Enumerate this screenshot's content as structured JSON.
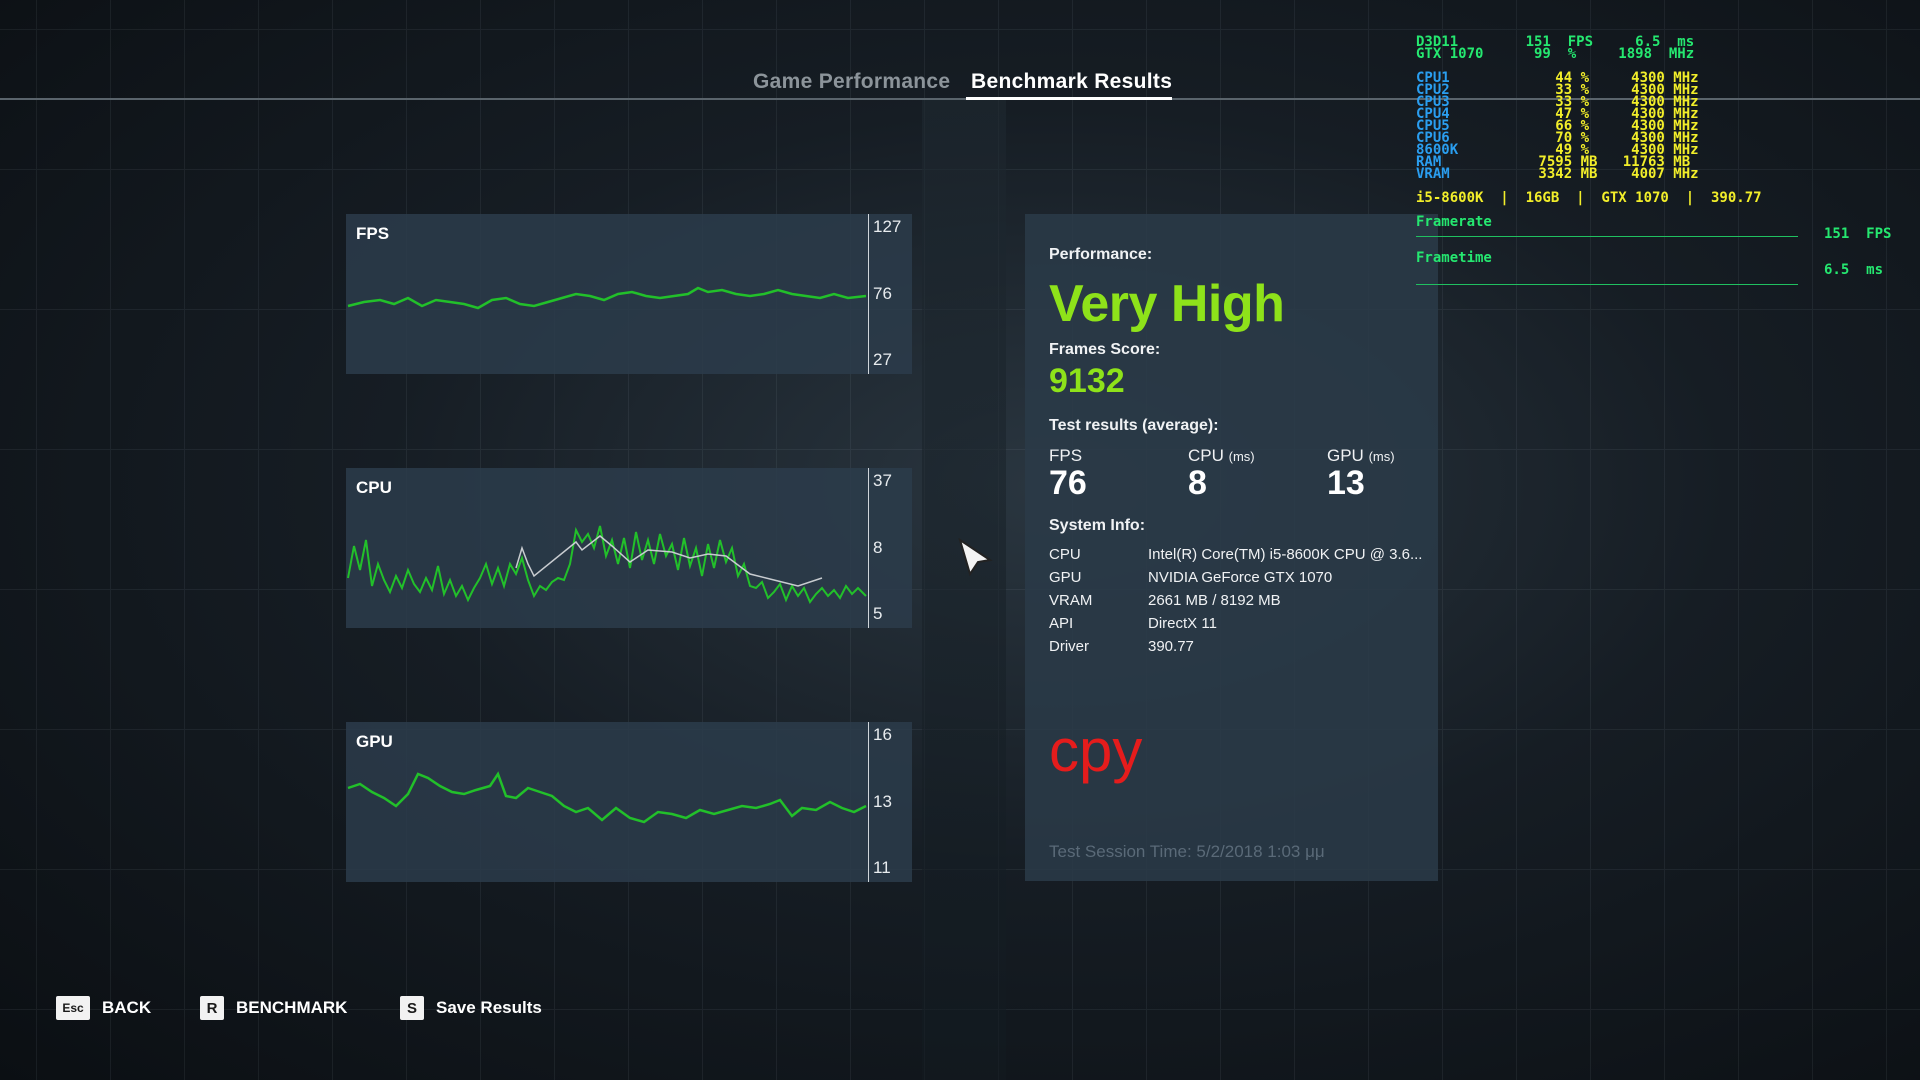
{
  "tabs": [
    {
      "label": "Game Performance",
      "active": false
    },
    {
      "label": "Benchmark Results",
      "active": true
    }
  ],
  "graphs": {
    "fps": {
      "title": "FPS",
      "ticks": [
        "127",
        "76",
        "27"
      ],
      "series_color": "#22c02a"
    },
    "cpu": {
      "title": "CPU",
      "ticks": [
        "37",
        "8",
        "5"
      ],
      "series_color": "#22c02a"
    },
    "gpu": {
      "title": "GPU",
      "ticks": [
        "16",
        "13",
        "11"
      ],
      "series_color": "#22c02a"
    }
  },
  "results": {
    "performance_label": "Performance:",
    "performance_value": "Very High",
    "score_label": "Frames Score:",
    "score_value": "9132",
    "test_label": "Test results (average):",
    "stats": [
      {
        "label": "FPS",
        "unit": "",
        "value": "76"
      },
      {
        "label": "CPU",
        "unit": "(ms)",
        "value": "8"
      },
      {
        "label": "GPU",
        "unit": "(ms)",
        "value": "13"
      }
    ],
    "system_label": "System Info:",
    "system": [
      {
        "key": "CPU",
        "value": "Intel(R) Core(TM) i5-8600K CPU @ 3.6..."
      },
      {
        "key": "GPU",
        "value": "NVIDIA GeForce GTX 1070"
      },
      {
        "key": "VRAM",
        "value": "2661 MB / 8192 MB"
      },
      {
        "key": "API",
        "value": "DirectX 11"
      },
      {
        "key": "Driver",
        "value": "390.77"
      }
    ],
    "stamp": "cpy",
    "session": "Test Session Time: 5/2/2018 1:03 μμ"
  },
  "overlay": {
    "d3d_line": "D3D11        151  FPS     6.5  ms",
    "gtx_line": "GTX 1070      99  %     1898  MHz",
    "cpu_rows": [
      {
        "name": "CPU1",
        "value": "44",
        "unit": "%",
        "clock": "4300",
        "clock_unit": "MHz"
      },
      {
        "name": "CPU2",
        "value": "33",
        "unit": "%",
        "clock": "4300",
        "clock_unit": "MHz"
      },
      {
        "name": "CPU3",
        "value": "33",
        "unit": "%",
        "clock": "4300",
        "clock_unit": "MHz"
      },
      {
        "name": "CPU4",
        "value": "47",
        "unit": "%",
        "clock": "4300",
        "clock_unit": "MHz"
      },
      {
        "name": "CPU5",
        "value": "66",
        "unit": "%",
        "clock": "4300",
        "clock_unit": "MHz"
      },
      {
        "name": "CPU6",
        "value": "70",
        "unit": "%",
        "clock": "4300",
        "clock_unit": "MHz"
      },
      {
        "name": "8600K",
        "value": "49",
        "unit": "%",
        "clock": "4300",
        "clock_unit": "MHz"
      },
      {
        "name": "RAM",
        "value": "7595",
        "unit": "MB",
        "clock": "11763",
        "clock_unit": "MB"
      },
      {
        "name": "VRAM",
        "value": "3342",
        "unit": "MB",
        "clock": "4007",
        "clock_unit": "MHz"
      }
    ],
    "system_line": "i5-8600K  |  16GB  |  GTX 1070  |  390.77",
    "framerate_label": "Framerate",
    "framerate_value": "151  FPS",
    "frametime_label": "Frametime",
    "frametime_value": "6.5  ms"
  },
  "footer": {
    "buttons": [
      {
        "key": "Esc",
        "label": "BACK"
      },
      {
        "key": "R",
        "label": "BENCHMARK"
      },
      {
        "key": "S",
        "label": "Save Results"
      }
    ]
  }
}
